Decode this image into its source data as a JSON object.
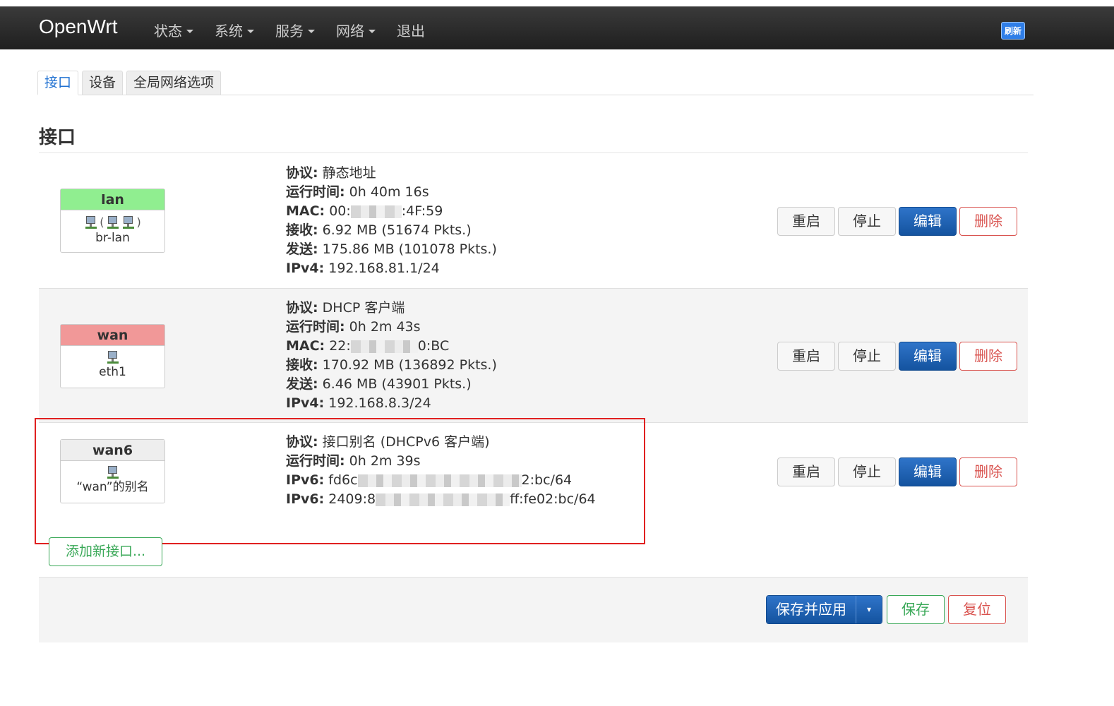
{
  "navbar": {
    "brand": "OpenWrt",
    "menu": [
      {
        "label": "状态",
        "has_caret": true
      },
      {
        "label": "系统",
        "has_caret": true
      },
      {
        "label": "服务",
        "has_caret": true
      },
      {
        "label": "网络",
        "has_caret": true
      },
      {
        "label": "退出",
        "has_caret": false
      }
    ],
    "refresh_badge": "刷新"
  },
  "tabs": [
    {
      "label": "接口",
      "active": true
    },
    {
      "label": "设备",
      "active": false
    },
    {
      "label": "全局网络选项",
      "active": false
    }
  ],
  "section_title": "接口",
  "interfaces": [
    {
      "name": "lan",
      "header_color": "#90ee90",
      "device": "br-lan",
      "icons_text": "(",
      "icons_text_end": ")",
      "info": [
        {
          "key": "协议:",
          "value": "静态地址"
        },
        {
          "key": "运行时间:",
          "value": "0h 40m 16s"
        },
        {
          "key": "MAC:",
          "value_start": "00:",
          "value_end": ":4F:59"
        },
        {
          "key": "接收:",
          "value": "6.92 MB (51674 Pkts.)"
        },
        {
          "key": "发送:",
          "value": "175.86 MB (101078 Pkts.)"
        },
        {
          "key": "IPv4:",
          "value": "192.168.81.1/24"
        }
      ]
    },
    {
      "name": "wan",
      "header_color": "#f19898",
      "device": "eth1",
      "info": [
        {
          "key": "协议:",
          "value": "DHCP 客户端"
        },
        {
          "key": "运行时间:",
          "value": "0h 2m 43s"
        },
        {
          "key": "MAC:",
          "value_start": "22:",
          "value_end": "0:BC"
        },
        {
          "key": "接收:",
          "value": "170.92 MB (136892 Pkts.)"
        },
        {
          "key": "发送:",
          "value": "6.46 MB (43901 Pkts.)"
        },
        {
          "key": "IPv4:",
          "value": "192.168.8.3/24"
        }
      ]
    },
    {
      "name": "wan6",
      "header_color": "#eeeeee",
      "device": "“wan”的别名",
      "info": [
        {
          "key": "协议:",
          "value": "接口别名 (DHCPv6 客户端)"
        },
        {
          "key": "运行时间:",
          "value": "0h 2m 39s"
        },
        {
          "key": "IPv6:",
          "value_start": "fd6c",
          "value_end": "2:bc/64"
        },
        {
          "key": "IPv6:",
          "value_start": "2409:8",
          "value_end": "ff:fe02:bc/64"
        }
      ]
    }
  ],
  "row_buttons": {
    "restart": "重启",
    "stop": "停止",
    "edit": "编辑",
    "delete": "删除"
  },
  "add_interface": "添加新接口...",
  "footer": {
    "save_apply": "保存并应用",
    "dropdown": "▾",
    "save": "保存",
    "reset": "复位"
  },
  "colors": {
    "primary": "#1a5fb4",
    "danger": "#d9534f",
    "success": "#39a857",
    "highlight": "#e02020"
  }
}
